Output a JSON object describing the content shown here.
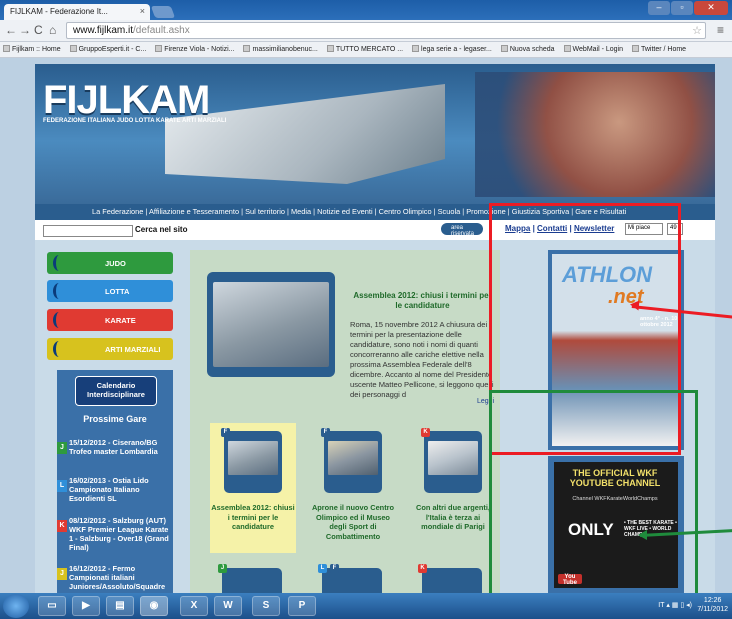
{
  "browser": {
    "tab_title": "FIJLKAM - Federazione It...",
    "tab_close": "×",
    "url_host": "www.fijlkam.it",
    "url_path": "/default.ashx",
    "bookmarks": [
      "Fijlkam :: Home",
      "GruppoEsperti.it - C...",
      "Firenze Viola - Notizi...",
      "massimilianobenuc...",
      "TUTTO MERCATO ...",
      "lega serie a - legaser...",
      "Nuova scheda",
      "WebMail - Login",
      "Twitter / Home"
    ]
  },
  "header": {
    "logo": "FIJLKAM",
    "logo_subtitle": "FEDERAZIONE ITALIANA JUDO LOTTA KARATE ARTI MARZIALI"
  },
  "menu": "La Federazione | Affiliazione e Tesseramento | Sul territorio | Media | Notizie ed Eventi | Centro Olimpico | Scuola | Promozione | Giustizia Sportiva | Gare e Risultati",
  "search": {
    "label": "Cerca nel sito",
    "placeholder": ""
  },
  "top_links": {
    "area_riservata": "area riservata",
    "mappa": "Mappa",
    "contatti": "Contatti",
    "newsletter": "Newsletter",
    "fb_like": "Mi piace",
    "fb_count": "49"
  },
  "sports": [
    {
      "label": "JUDO",
      "color": "#2e9a3e"
    },
    {
      "label": "LOTTA",
      "color": "#2f8fd9"
    },
    {
      "label": "KARATE",
      "color": "#e03a32"
    },
    {
      "label": "ARTI MARZIALI",
      "color": "#d7c21e"
    }
  ],
  "calendar": {
    "button": "Calendario Interdisciplinare",
    "heading": "Prossime Gare",
    "events": [
      {
        "badge": "J",
        "badge_color": "#2e9a3e",
        "text": "15/12/2012 - Ciserano/BG Trofeo master Lombardia"
      },
      {
        "badge": "L",
        "badge_color": "#2f8fd9",
        "text": "16/02/2013 - Ostia Lido Campionato Italiano Esordienti SL"
      },
      {
        "badge": "K",
        "badge_color": "#e03a32",
        "text": "08/12/2012 - Salzburg (AUT) WKF Premier League Karate 1 - Salzburg - Over18 (Grand Final)"
      },
      {
        "badge": "J",
        "badge_color": "#d7c21e",
        "text": "16/12/2012 - Fermo Campionati italiani Juniores/Assoluto/Squadre"
      }
    ]
  },
  "featured": {
    "title": "Assemblea 2012: chiusi i termini per le candidature",
    "text": "Roma, 15 novembre 2012 A chiusura dei termini per la presentazione delle candidature, sono noti i nomi di quanti concorreranno alle cariche elettive nella prossima Assemblea Federale dell'8 dicembre. Accanto al nome del Presidente uscente Matteo Pellicone, si leggono quelli dei personaggi d",
    "leggi": "Leggi"
  },
  "news": [
    {
      "tag": "F",
      "tag_color": "#2a5d8e",
      "title": "Assemblea 2012: chiusi i termini per le candidature"
    },
    {
      "tag": "F",
      "tag_color": "#2a5d8e",
      "title": "Aprone il nuovo Centro Olimpico ed il Museo degli Sport di Combattimento"
    },
    {
      "tag": "K",
      "tag_color": "#e03a32",
      "title": "Con altri due argenti, l'Italia è terza ai mondiale di Parigi"
    }
  ],
  "more_news_tags": [
    {
      "tag": "J",
      "tag_color": "#2e9a3e"
    },
    {
      "tag": "L",
      "tag_color": "#2f8fd9"
    },
    {
      "tag": "F",
      "tag_color": "#2a5d8e"
    },
    {
      "tag": "K",
      "tag_color": "#e03a32"
    }
  ],
  "athlon": {
    "logo": "ATHLON",
    "suffix": ".net",
    "issue": "anno 4° - n. 10 ottobre 2012"
  },
  "wkf": {
    "title": "THE OFFICIAL WKF YOUTUBE CHANNEL",
    "channel": "Channel WKFKarateWorldChamps",
    "only": "ONLY",
    "side": "• THE BEST KARATE • WKF LIVE • WORLD CHAMPS",
    "youtube": "You Tube"
  },
  "taskbar": {
    "lang": "IT",
    "time": "12:26",
    "date": "7/11/2012"
  }
}
